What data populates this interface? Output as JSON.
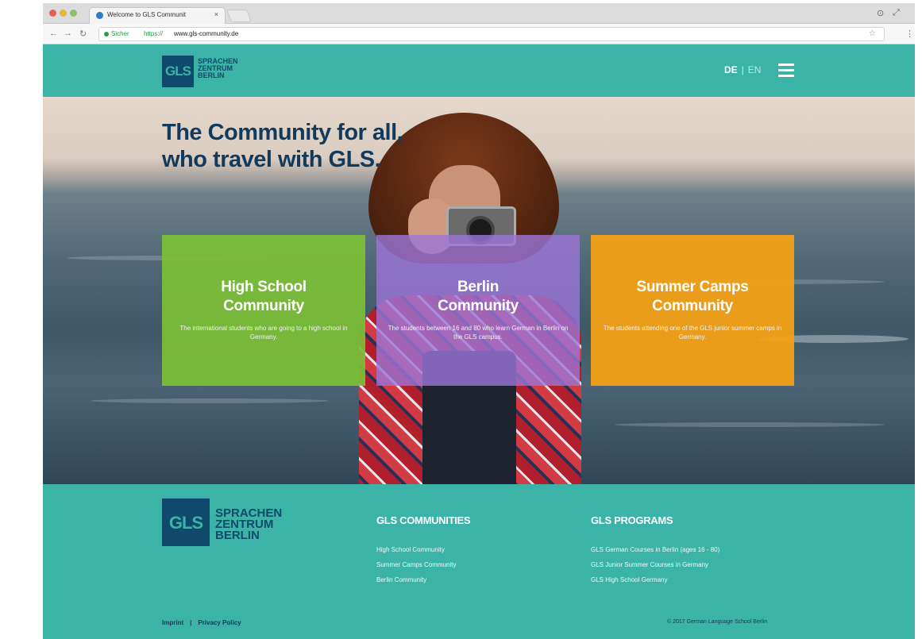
{
  "browser": {
    "tab_title": "Welcome to GLS Communit",
    "tab_close": "×",
    "secure_label": "Sicher",
    "url_scheme": "https://",
    "url_host": "www.gls-community.de",
    "icons": [
      "back-icon",
      "forward-icon",
      "reload-icon",
      "bookmark-star-icon",
      "menu-dots-icon"
    ]
  },
  "header": {
    "logo_letters": "GLS",
    "logo_line1": "SPRACHEN",
    "logo_line2": "ZENTRUM",
    "logo_line3": "BERLIN",
    "lang_active": "DE",
    "lang_separator": "|",
    "lang_other": "EN"
  },
  "hero": {
    "title_line1": "The Community for all,",
    "title_line2": "who travel with GLS."
  },
  "cards": [
    {
      "title_line1": "High School",
      "title_line2": "Community",
      "description": "The international students who are going to a high school in Germany.",
      "color": "#7cbe36"
    },
    {
      "title_line1": "Berlin",
      "title_line2": "Community",
      "description": "The students between 16 and 80 who learn German in Berlin on the GLS campus.",
      "color": "#9c76d8"
    },
    {
      "title_line1": "Summer Camps",
      "title_line2": "Community",
      "description": "The students attending one of the GLS junior summer camps in Germany.",
      "color": "#f4a216"
    }
  ],
  "footer": {
    "logo_letters": "GLS",
    "logo_line1": "SPRACHEN",
    "logo_line2": "ZENTRUM",
    "logo_line3": "BERLIN",
    "communities_title": "GLS COMMUNITIES",
    "communities": [
      "High School Community",
      "Summer Camps Community",
      "Berlin Community"
    ],
    "programs_title": "GLS PROGRAMS",
    "programs": [
      "GLS German Courses in Berlin (ages 16 - 80)",
      "GLS Junior Summer Courses in Germany",
      "GLS High School Germany"
    ],
    "imprint": "Imprint",
    "separator": "|",
    "privacy": "Privacy Policy",
    "copyright": "© 2017 German Language School Berlin"
  },
  "colors": {
    "brand_teal": "#3bb3a6",
    "brand_navy": "#0f4a6d",
    "title_navy": "#123a5c"
  }
}
